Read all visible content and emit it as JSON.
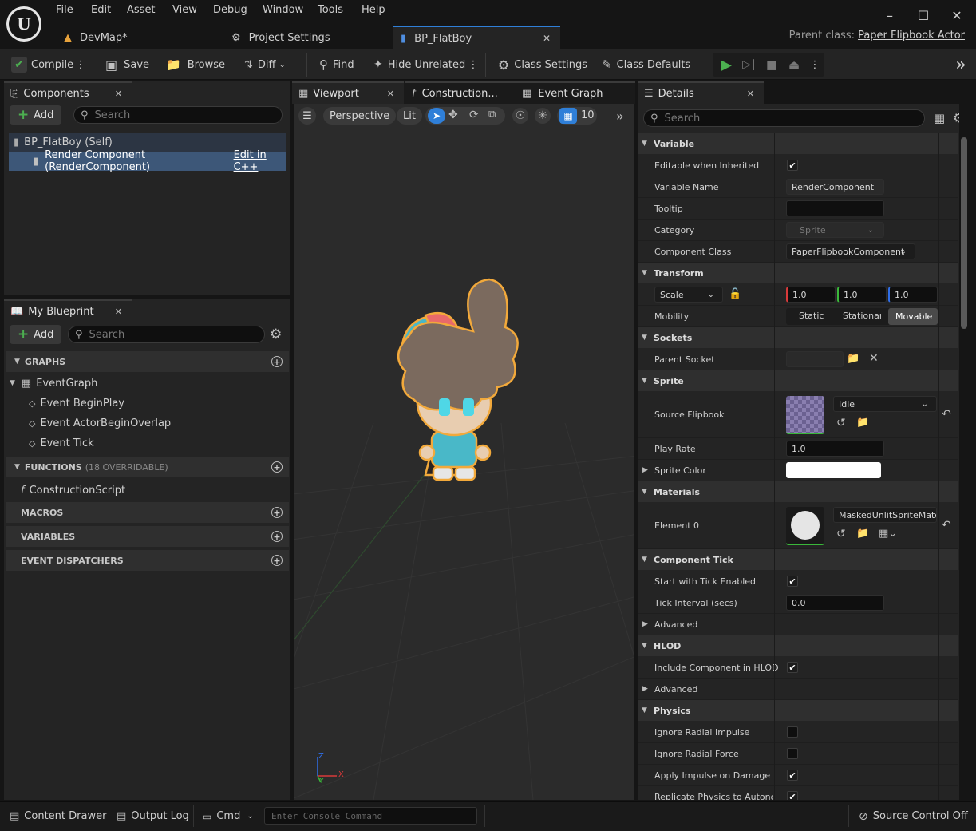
{
  "menu": [
    "File",
    "Edit",
    "Asset",
    "View",
    "Debug",
    "Window",
    "Tools",
    "Help"
  ],
  "tabs": [
    {
      "label": "DevMap*"
    },
    {
      "label": "Project Settings"
    },
    {
      "label": "BP_FlatBoy"
    }
  ],
  "parent_class": {
    "label": "Parent class:",
    "value": "Paper Flipbook Actor"
  },
  "toolbar": {
    "compile": "Compile",
    "save": "Save",
    "browse": "Browse",
    "diff": "Diff",
    "find": "Find",
    "hide_unrelated": "Hide Unrelated",
    "class_settings": "Class Settings",
    "class_defaults": "Class Defaults"
  },
  "components": {
    "tab": "Components",
    "add": "Add",
    "search_placeholder": "Search",
    "self": "BP_FlatBoy (Self)",
    "render": "Render Component (RenderComponent)",
    "edit_cpp": "Edit in C++"
  },
  "my_blueprint": {
    "tab": "My Blueprint",
    "add": "Add",
    "search_placeholder": "Search",
    "graphs": "GRAPHS",
    "event_graph": "EventGraph",
    "events": [
      "Event BeginPlay",
      "Event ActorBeginOverlap",
      "Event Tick"
    ],
    "functions": "FUNCTIONS",
    "functions_count": "(18 OVERRIDABLE)",
    "construction_script": "ConstructionScript",
    "macros": "MACROS",
    "variables": "VARIABLES",
    "event_dispatchers": "EVENT DISPATCHERS"
  },
  "center_tabs": [
    "Viewport",
    "Construction...",
    "Event Graph"
  ],
  "viewport": {
    "perspective": "Perspective",
    "lit": "Lit",
    "grid": "10",
    "axis_z": "Z",
    "axis_x": "X",
    "axis_y": "Y"
  },
  "details": {
    "tab": "Details",
    "search_placeholder": "Search",
    "variable": "Variable",
    "editable_inherited": "Editable when Inherited",
    "variable_name": "Variable Name",
    "variable_name_value": "RenderComponent",
    "tooltip": "Tooltip",
    "category": "Category",
    "category_value": "Sprite",
    "component_class": "Component Class",
    "component_class_value": "PaperFlipbookComponent",
    "transform": "Transform",
    "scale": "Scale",
    "scale_x": "1.0",
    "scale_y": "1.0",
    "scale_z": "1.0",
    "mobility": "Mobility",
    "mob_static": "Static",
    "mob_stationary": "Stationar",
    "mob_movable": "Movable",
    "sockets": "Sockets",
    "parent_socket": "Parent Socket",
    "sprite": "Sprite",
    "source_flipbook": "Source Flipbook",
    "flipbook_value": "Idle",
    "play_rate": "Play Rate",
    "play_rate_value": "1.0",
    "sprite_color": "Sprite Color",
    "materials": "Materials",
    "element0": "Element 0",
    "material_value": "MaskedUnlitSpriteMateri",
    "component_tick": "Component Tick",
    "start_tick": "Start with Tick Enabled",
    "tick_interval": "Tick Interval (secs)",
    "tick_interval_value": "0.0",
    "advanced": "Advanced",
    "hlod": "HLOD",
    "include_hlod": "Include Component in HLOD",
    "advanced2": "Advanced",
    "physics": "Physics",
    "ignore_radial_impulse": "Ignore Radial Impulse",
    "ignore_radial_force": "Ignore Radial Force",
    "apply_impulse": "Apply Impulse on Damage",
    "replicate_physics": "Replicate Physics to Autono..."
  },
  "statusbar": {
    "content_drawer": "Content Drawer",
    "output_log": "Output Log",
    "cmd": "Cmd",
    "console_placeholder": "Enter Console Command",
    "source_control": "Source Control Off"
  },
  "colors": {
    "accent": "#2f7fd8",
    "play": "#4caf50",
    "highlight": "#3d5778"
  }
}
